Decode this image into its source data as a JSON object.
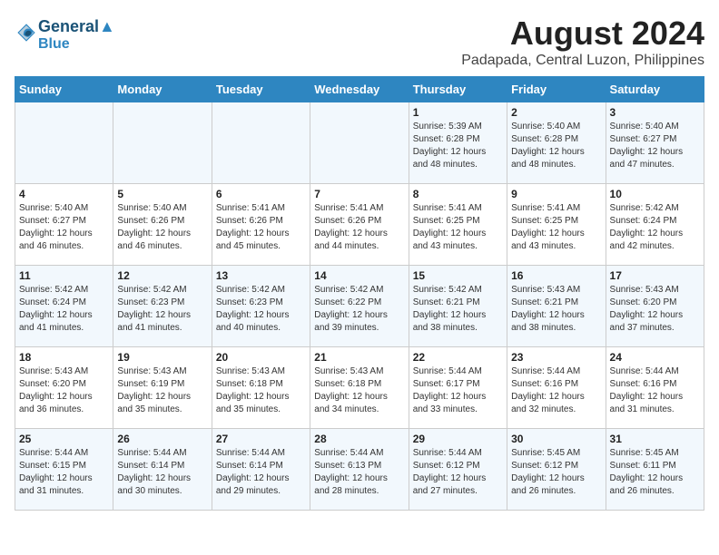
{
  "logo": {
    "line1": "General",
    "line2": "Blue"
  },
  "title": "August 2024",
  "subtitle": "Padapada, Central Luzon, Philippines",
  "days_of_week": [
    "Sunday",
    "Monday",
    "Tuesday",
    "Wednesday",
    "Thursday",
    "Friday",
    "Saturday"
  ],
  "weeks": [
    [
      {
        "day": "",
        "info": ""
      },
      {
        "day": "",
        "info": ""
      },
      {
        "day": "",
        "info": ""
      },
      {
        "day": "",
        "info": ""
      },
      {
        "day": "1",
        "info": "Sunrise: 5:39 AM\nSunset: 6:28 PM\nDaylight: 12 hours\nand 48 minutes."
      },
      {
        "day": "2",
        "info": "Sunrise: 5:40 AM\nSunset: 6:28 PM\nDaylight: 12 hours\nand 48 minutes."
      },
      {
        "day": "3",
        "info": "Sunrise: 5:40 AM\nSunset: 6:27 PM\nDaylight: 12 hours\nand 47 minutes."
      }
    ],
    [
      {
        "day": "4",
        "info": "Sunrise: 5:40 AM\nSunset: 6:27 PM\nDaylight: 12 hours\nand 46 minutes."
      },
      {
        "day": "5",
        "info": "Sunrise: 5:40 AM\nSunset: 6:26 PM\nDaylight: 12 hours\nand 46 minutes."
      },
      {
        "day": "6",
        "info": "Sunrise: 5:41 AM\nSunset: 6:26 PM\nDaylight: 12 hours\nand 45 minutes."
      },
      {
        "day": "7",
        "info": "Sunrise: 5:41 AM\nSunset: 6:26 PM\nDaylight: 12 hours\nand 44 minutes."
      },
      {
        "day": "8",
        "info": "Sunrise: 5:41 AM\nSunset: 6:25 PM\nDaylight: 12 hours\nand 43 minutes."
      },
      {
        "day": "9",
        "info": "Sunrise: 5:41 AM\nSunset: 6:25 PM\nDaylight: 12 hours\nand 43 minutes."
      },
      {
        "day": "10",
        "info": "Sunrise: 5:42 AM\nSunset: 6:24 PM\nDaylight: 12 hours\nand 42 minutes."
      }
    ],
    [
      {
        "day": "11",
        "info": "Sunrise: 5:42 AM\nSunset: 6:24 PM\nDaylight: 12 hours\nand 41 minutes."
      },
      {
        "day": "12",
        "info": "Sunrise: 5:42 AM\nSunset: 6:23 PM\nDaylight: 12 hours\nand 41 minutes."
      },
      {
        "day": "13",
        "info": "Sunrise: 5:42 AM\nSunset: 6:23 PM\nDaylight: 12 hours\nand 40 minutes."
      },
      {
        "day": "14",
        "info": "Sunrise: 5:42 AM\nSunset: 6:22 PM\nDaylight: 12 hours\nand 39 minutes."
      },
      {
        "day": "15",
        "info": "Sunrise: 5:42 AM\nSunset: 6:21 PM\nDaylight: 12 hours\nand 38 minutes."
      },
      {
        "day": "16",
        "info": "Sunrise: 5:43 AM\nSunset: 6:21 PM\nDaylight: 12 hours\nand 38 minutes."
      },
      {
        "day": "17",
        "info": "Sunrise: 5:43 AM\nSunset: 6:20 PM\nDaylight: 12 hours\nand 37 minutes."
      }
    ],
    [
      {
        "day": "18",
        "info": "Sunrise: 5:43 AM\nSunset: 6:20 PM\nDaylight: 12 hours\nand 36 minutes."
      },
      {
        "day": "19",
        "info": "Sunrise: 5:43 AM\nSunset: 6:19 PM\nDaylight: 12 hours\nand 35 minutes."
      },
      {
        "day": "20",
        "info": "Sunrise: 5:43 AM\nSunset: 6:18 PM\nDaylight: 12 hours\nand 35 minutes."
      },
      {
        "day": "21",
        "info": "Sunrise: 5:43 AM\nSunset: 6:18 PM\nDaylight: 12 hours\nand 34 minutes."
      },
      {
        "day": "22",
        "info": "Sunrise: 5:44 AM\nSunset: 6:17 PM\nDaylight: 12 hours\nand 33 minutes."
      },
      {
        "day": "23",
        "info": "Sunrise: 5:44 AM\nSunset: 6:16 PM\nDaylight: 12 hours\nand 32 minutes."
      },
      {
        "day": "24",
        "info": "Sunrise: 5:44 AM\nSunset: 6:16 PM\nDaylight: 12 hours\nand 31 minutes."
      }
    ],
    [
      {
        "day": "25",
        "info": "Sunrise: 5:44 AM\nSunset: 6:15 PM\nDaylight: 12 hours\nand 31 minutes."
      },
      {
        "day": "26",
        "info": "Sunrise: 5:44 AM\nSunset: 6:14 PM\nDaylight: 12 hours\nand 30 minutes."
      },
      {
        "day": "27",
        "info": "Sunrise: 5:44 AM\nSunset: 6:14 PM\nDaylight: 12 hours\nand 29 minutes."
      },
      {
        "day": "28",
        "info": "Sunrise: 5:44 AM\nSunset: 6:13 PM\nDaylight: 12 hours\nand 28 minutes."
      },
      {
        "day": "29",
        "info": "Sunrise: 5:44 AM\nSunset: 6:12 PM\nDaylight: 12 hours\nand 27 minutes."
      },
      {
        "day": "30",
        "info": "Sunrise: 5:45 AM\nSunset: 6:12 PM\nDaylight: 12 hours\nand 26 minutes."
      },
      {
        "day": "31",
        "info": "Sunrise: 5:45 AM\nSunset: 6:11 PM\nDaylight: 12 hours\nand 26 minutes."
      }
    ]
  ]
}
